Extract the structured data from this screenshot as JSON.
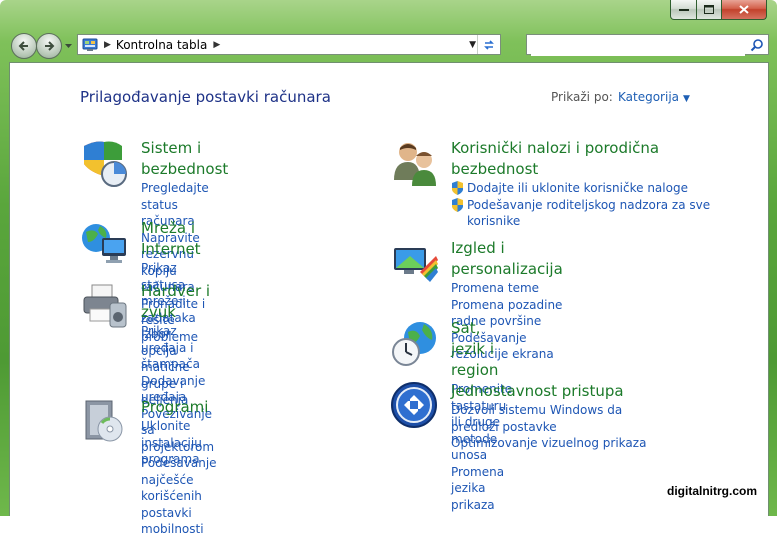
{
  "toolbar": {
    "breadcrumb": "Kontrolna tabla",
    "search_placeholder": ""
  },
  "header": {
    "title": "Prilagođavanje postavki računara",
    "view_by_label": "Prikaži po:",
    "view_by_value": "Kategorija"
  },
  "categories": [
    {
      "title": "Sistem i bezbednost",
      "links": [
        "Pregledajte status računara",
        "Napravite rezervnu kopiju računara",
        "Pronađite i rešite probleme"
      ]
    },
    {
      "title": "Mreža i Internet",
      "links": [
        "Prikaz statusa mreže i zadataka",
        "Izbor opcija matične grupe i deljenja"
      ]
    },
    {
      "title": "Hardver i zvuk",
      "links": [
        "Prikaz uređaja i štampača",
        "Dodavanje uređaja",
        "Povezivanje sa projektorom",
        "Podešavanje najčešće korišćenih postavki mobilnosti"
      ]
    },
    {
      "title": "Programi",
      "links": [
        "Uklonite instalaciju programa"
      ]
    },
    {
      "title": "Korisnički nalozi i porodična bezbednost",
      "links": [
        "Dodajte ili uklonite korisničke naloge",
        "Podešavanje roditeljskog nadzora za sve korisnike"
      ]
    },
    {
      "title": "Izgled i personalizacija",
      "links": [
        "Promena teme",
        "Promena pozadine radne površine",
        "Podešavanje rezolucije ekrana"
      ]
    },
    {
      "title": "Sat, jezik i region",
      "links": [
        "Promenite tastaturu ili druge metode unosa",
        "Promena jezika prikaza"
      ]
    },
    {
      "title": "Jednostavnost pristupa",
      "links": [
        "Dozvoli sistemu Windows da predloži postavke",
        "Optimizovanje vizuelnog prikaza"
      ]
    }
  ],
  "watermark": "digitalnitrg.com"
}
